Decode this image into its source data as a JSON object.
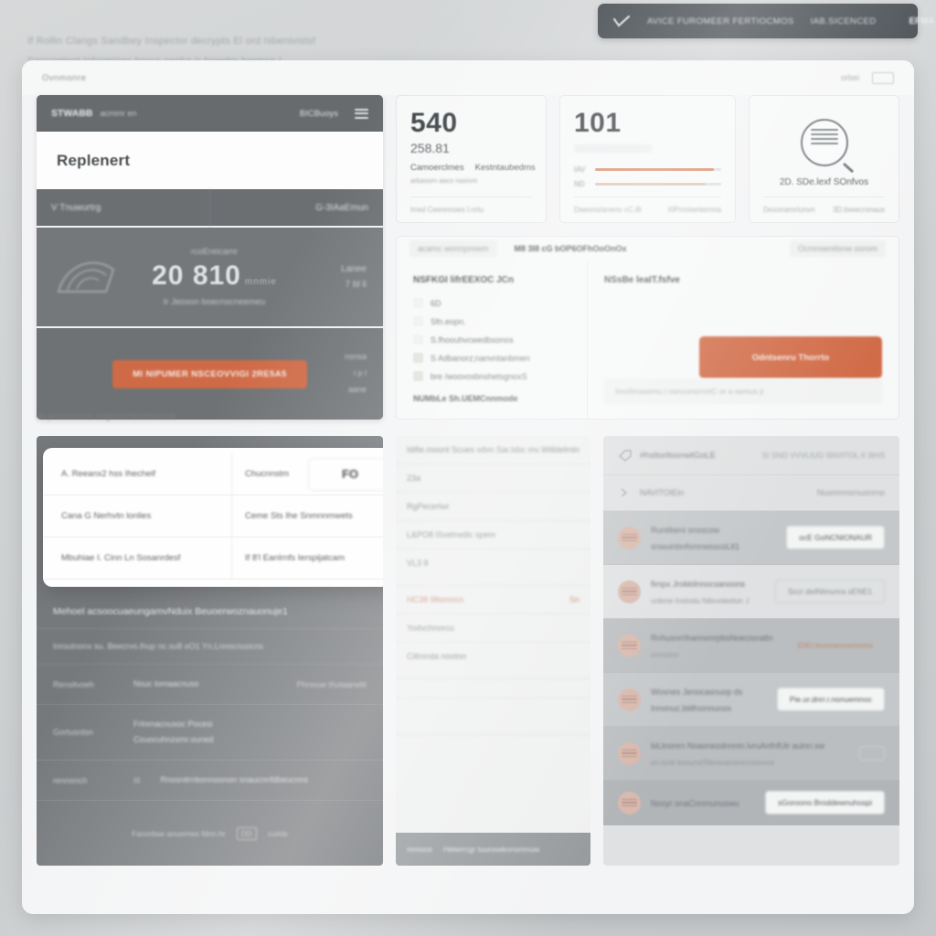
{
  "intro": {
    "lines": [
      "If Rollin Clangs Sandbey  Inspector decrypts El ord  Isbenivistsf",
      "Sancontent  Informings  broce spoke  Ir  browler  hormse |"
    ]
  },
  "navbar": {
    "logo_icon": "checkmark-logo-icon",
    "items": [
      "AVICE FUROMEER FERTIOCMOS",
      "IAB.SICENCED"
    ],
    "right_label": "EFMA"
  },
  "window": {
    "title": "Ovnmonre",
    "top_label": "orbei",
    "top_icon": "card-icon"
  },
  "dark_card": {
    "title": "STWABB",
    "subtitle": "acmmr en",
    "right_label": "BICBuoys",
    "menu_icon": "hamburger-menu-icon",
    "heading": "Replenert",
    "tabs": [
      "V Tnuwurtrg",
      "G-3IAaEmun"
    ],
    "hero": {
      "icon": "signal-arc-icon",
      "label": "rcoEreicamr",
      "value": "20 810",
      "value_suffix": "mnmie",
      "caption": "Ir Jeoxon boecnscneemeu",
      "side_top": "Lanee",
      "side_bottom": "7 bl li"
    },
    "cta_label": "MI NIPUMER NSCEOVVIGI 2RE5A5",
    "foot_right": [
      "nsnsa",
      "i p l",
      "aane"
    ]
  },
  "stats": {
    "card1": {
      "big": "540",
      "mid": "258.81",
      "labels": [
        "Camoerclmes",
        "Kestntaubedms"
      ],
      "note": "arbasom aacx nasivre",
      "foot": [
        "Irred Ceennnoes I.nrtu",
        ""
      ]
    },
    "card2": {
      "big": "101",
      "ghost": "",
      "bars": [
        {
          "label": "IAV",
          "value": 94,
          "color": "#d98f6e"
        },
        {
          "label": "ND",
          "value": 88,
          "color": "#e6c2b0"
        }
      ],
      "foot": [
        "Daeono/aneno cC.iB",
        "I0Prnniwnternna"
      ]
    },
    "card3": {
      "icon": "magnifier-document-icon",
      "caption": "2D. SDe.lexf SOnfvos",
      "foot": [
        "Desonamrtunvn",
        "3D.bwwcronaus"
      ]
    }
  },
  "panel": {
    "tabs": [
      {
        "label": "acamc wonnprowm",
        "active": false
      },
      {
        "label": "M8 3I8 cG  bOP6OFhOoOnOx",
        "active": true
      },
      {
        "label": "Ocmnsenitsnw oorom",
        "active": false
      }
    ],
    "left_heading": "NSFKGI lifrEEXOC JCn",
    "items": [
      {
        "text": "6D",
        "faint": true
      },
      {
        "text": "Sfn.eopn.",
        "faint": true
      },
      {
        "text": "S.fhoouhvcwedbsonos",
        "faint": true
      },
      {
        "text": "S Adbanorz;nanvntanbmen",
        "faint": false
      },
      {
        "text": "bre /woovosbnshetsgnoxS",
        "faint": false
      }
    ],
    "footnote": "NUMbLe Sh.UEMCnnmode",
    "right_heading": "NSsBe leaIT.fsfve",
    "cta_label": "Odntsenru Thorrto",
    "fineprint": "Inrofimasemu.l  oanvunernntC or a  semus jr"
  },
  "bottom_caption": "an.prconcmoos acigrnonmenencemsk",
  "overlay_card": {
    "rows": [
      {
        "c1": "A. Reeanx2 hss Ihecheif",
        "c2": "Chucnnstm",
        "pill": "FO"
      },
      {
        "c1": "Cana G Nerhvtn lonlies",
        "c2": "Ceme Sts Ihe Snmnnmwets",
        "pill": null
      },
      {
        "c1": "Mbuhiae I. Cinn Ln Sosanrdesf",
        "c2": "If 8'l  EanIrnfs Ierspijatcam",
        "pill": null
      }
    ],
    "badge": "orange-notification-badge"
  },
  "dark_table": {
    "title": "Mehoel acsoocuaeungamvNduix  Beuoerwoznauonuje1",
    "subtitle": "Inroutnonx  su. Beecrvo.lhup nc.su8  oO1 Yn.Lnnocnuocns",
    "rows": [
      {
        "k": "Rensitvoeh",
        "v": "Nsuc lomaacnuso",
        "x": "Phnouw thutaarwtti"
      },
      {
        "k": "Gortusntsn",
        "v": "Frlnrnacnusoc Pocesi\nCouocuhnzsmr.ouned",
        "x": ""
      },
      {
        "k": "rennonch",
        "v": "Rnosnitrnbonnoonon snaucnnfdbeucnns",
        "x": "III"
      }
    ],
    "foot": [
      "Fanorbse anuornes fdnn.hr",
      "cuinls"
    ],
    "keycap_icon": "keyboard-key-icon"
  },
  "mid_list": {
    "rows": [
      {
        "text": "Idifie.moont  Scues  vdvn  Sar.lsbc mv.",
        "right": "Wtiblelmtn",
        "bar": null
      },
      {
        "text": "23a",
        "right": "",
        "bar": null
      },
      {
        "text": "RgPecerlwr",
        "right": "",
        "bar": null
      },
      {
        "text": "L&PO8  lSvetrwdic spem",
        "right": "",
        "bar": null
      },
      {
        "text": "VL3 8",
        "right": "",
        "bar": null
      },
      {
        "text": "HC38 9flomncn",
        "right": "Sn",
        "bar": null,
        "hl": true
      },
      {
        "text": "Yodvchnorcu",
        "right": "",
        "bar": "orange"
      },
      {
        "text": "Cillmnda nooton",
        "right": "",
        "bar": null
      },
      {
        "text": "",
        "right": "",
        "bar": "blue"
      },
      {
        "text": "",
        "right": "",
        "bar": "blue-s"
      }
    ],
    "footer": [
      "mmoos",
      "Heterrcgr  tuunswkonsmnuw"
    ]
  },
  "right_list": {
    "header": {
      "icon": "tag-icon",
      "title": "#hsttorlloonwtGoLE",
      "right": "SI SND VVVLIUG SNVITOL.II 3IHS"
    },
    "subheader": {
      "icon": "chevron-icon",
      "title": "NAVITOIEin",
      "right": "Nusnmnsrnuonrno"
    },
    "items": [
      {
        "text": "Runtibeni snsscow snwuinbnfsmnwsscoLtl1",
        "sub": "",
        "button": "ocE GoNCNIONAUR",
        "button_style": "strong",
        "row_style": "dim"
      },
      {
        "text": "fimpx Jrokkilnnocsanoons",
        "sub": "unbme Inslostu fobruoiestun .I",
        "button": "Sccr deINtinunra sENE1",
        "button_style": "ghost",
        "row_style": ""
      },
      {
        "text": "RnhusnrrlhannonrpbsNoecisnaltn",
        "sub": "onvoonn",
        "button": "IDID.Inonoennemoms",
        "button_style": "link",
        "row_style": "dimmer"
      },
      {
        "text": "Wosnes Jenocasnuop  ds  Innonuc.btilfnonnunos",
        "sub": "",
        "button": "Pie.ur.dnrr.r.nonuemnoc",
        "button_style": "ghost",
        "row_style": "dim"
      },
      {
        "text": "biLtnonrn Noasnezdnnnin.lvruAnfnfUlr  aulnn.sw",
        "sub": "on.tonb  boouns/Sttnosanoroncoonnos",
        "button": "",
        "button_style": "",
        "row_style": "dimmer"
      },
      {
        "text": "Nosyr onaCnnrnunuswu",
        "sub": "",
        "button": "sGoroono Broddewnuhospi",
        "button_style": "strong",
        "row_style": "last"
      }
    ]
  },
  "colors": {
    "accent_orange": "#d16c48",
    "dark_panel": "#6f7376",
    "navbar_dark": "#3c4248",
    "page_bg": "#cfd2d3"
  }
}
